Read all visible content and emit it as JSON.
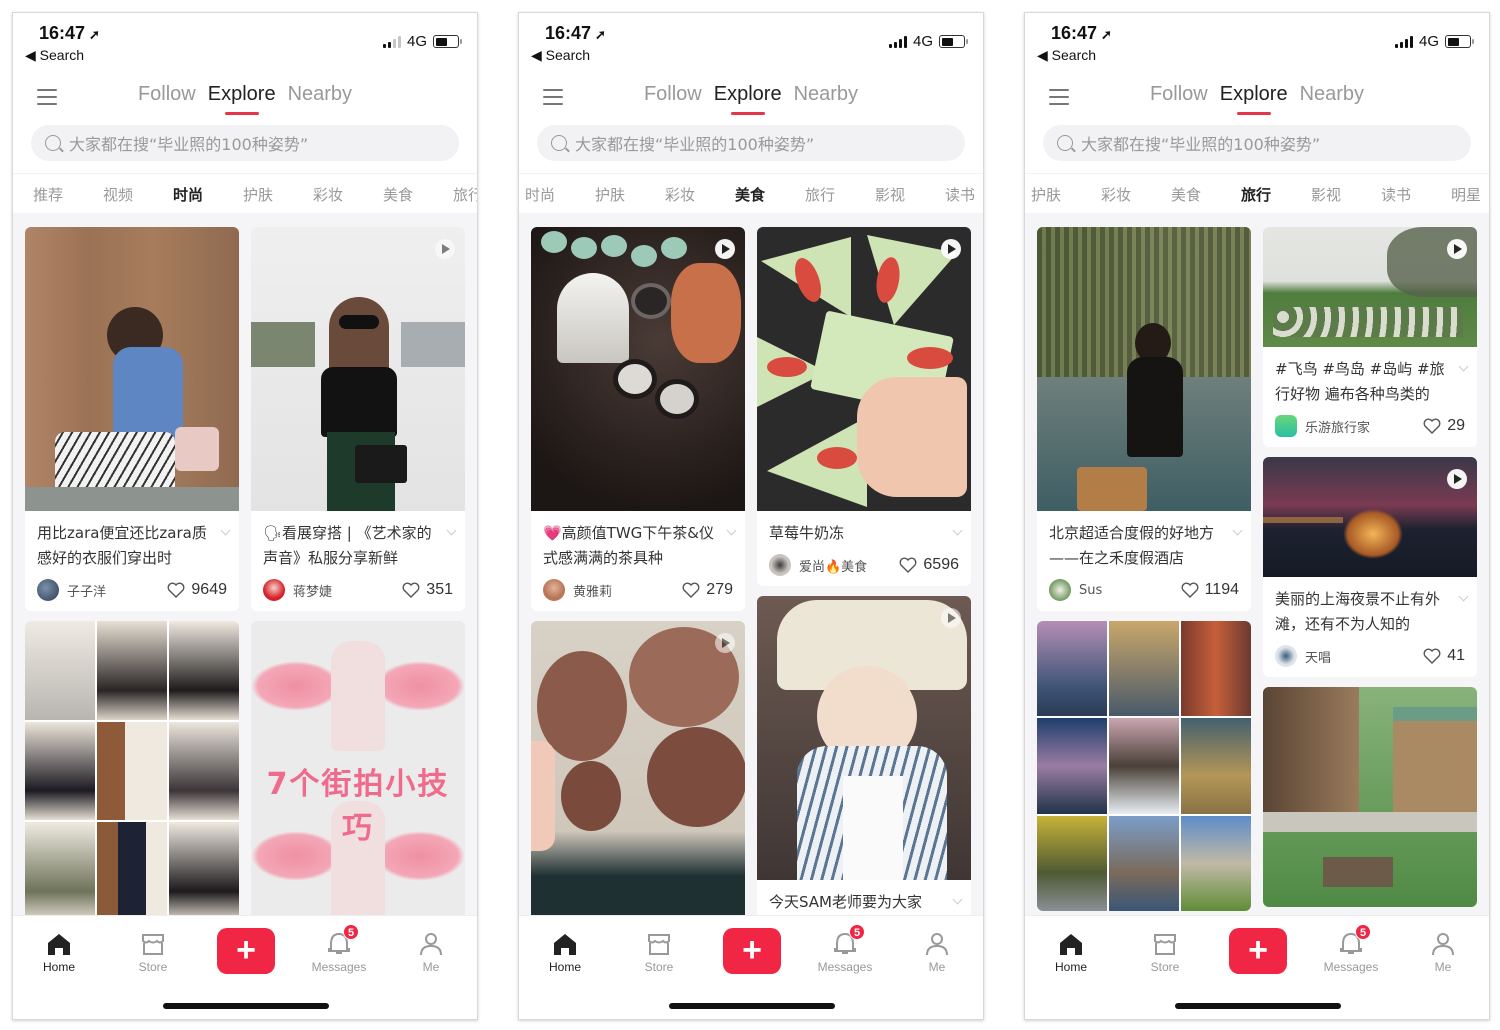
{
  "status_bar": {
    "time": "16:47",
    "back_label": "Search",
    "network": "4G"
  },
  "top_tabs": [
    "Follow",
    "Explore",
    "Nearby"
  ],
  "active_top_tab": "Explore",
  "search": {
    "placeholder": "大家都在搜“毕业照的100种姿势”"
  },
  "tab_bar": {
    "home": "Home",
    "store": "Store",
    "messages": "Messages",
    "me": "Me",
    "messages_badge": "5",
    "create_label": "+"
  },
  "accent_color": "#f02644",
  "screens": [
    {
      "categories": [
        "推荐",
        "视频",
        "时尚",
        "护肤",
        "彩妆",
        "美食",
        "旅行"
      ],
      "active_category": "时尚",
      "columns": [
        [
          {
            "title": "用比zara便宜还比zara质感好的衣服们穿出时",
            "author": "子子洋",
            "likes": "9649",
            "video": false,
            "image": "woman in blue shirt and striped skirt"
          },
          {
            "title": "",
            "author": "",
            "likes": "",
            "video": false,
            "image": "9-grid fashion outfits collage"
          }
        ],
        [
          {
            "title": "🗣看展穿搭 | 《艺术家的声音》私服分享新鲜",
            "author": "蒋梦婕",
            "likes": "351",
            "video": true,
            "image": "woman in sunglasses at gallery"
          },
          {
            "title": "",
            "author": "",
            "likes": "",
            "video": false,
            "image": "girl with painted pink wings",
            "overlay_text": "7个街拍小技巧"
          }
        ]
      ]
    },
    {
      "categories": [
        "时尚",
        "护肤",
        "彩妆",
        "美食",
        "旅行",
        "影视",
        "读书"
      ],
      "active_category": "美食",
      "columns": [
        [
          {
            "title": "💗高颜值TWG下午茶&仪式感满满的茶具种",
            "author": "黄雅莉",
            "likes": "279",
            "video": true,
            "image": "tea set with celadon cups"
          },
          {
            "title": "",
            "author": "",
            "likes": "",
            "video": true,
            "image": "cocoa mochi buns on plate"
          }
        ],
        [
          {
            "title": "草莓牛奶冻",
            "author": "爱尚🔥美食",
            "likes": "6596",
            "video": true,
            "image": "strawberry milk jelly slices"
          },
          {
            "title": "今天SAM老师要为大家",
            "author": "",
            "likes": "",
            "video": true,
            "image": "woman in bucket hat"
          }
        ]
      ]
    },
    {
      "categories": [
        "护肤",
        "彩妆",
        "美食",
        "旅行",
        "影视",
        "读书",
        "明星"
      ],
      "active_category": "旅行",
      "columns": [
        [
          {
            "title": "北京超适合度假的好地方——在之禾度假酒店",
            "author": "Sus",
            "likes": "1194",
            "video": false,
            "image": "woman at hot spring pool"
          },
          {
            "title": "",
            "author": "",
            "likes": "",
            "video": false,
            "image": "9-grid landscape collage"
          }
        ],
        [
          {
            "title": "#飞鸟 #鸟岛 #岛屿 #旅行好物 遍布各种鸟类的",
            "author": "乐游旅行家",
            "likes": "29",
            "video": true,
            "image": "albatross colony on island"
          },
          {
            "title": "美丽的上海夜景不止有外滩，还有不为人知的",
            "author": "天唱",
            "likes": "41",
            "video": true,
            "image": "Shanghai port at night"
          },
          {
            "title": "",
            "author": "",
            "likes": "",
            "video": false,
            "image": "wooden houses in forest"
          }
        ]
      ]
    }
  ]
}
